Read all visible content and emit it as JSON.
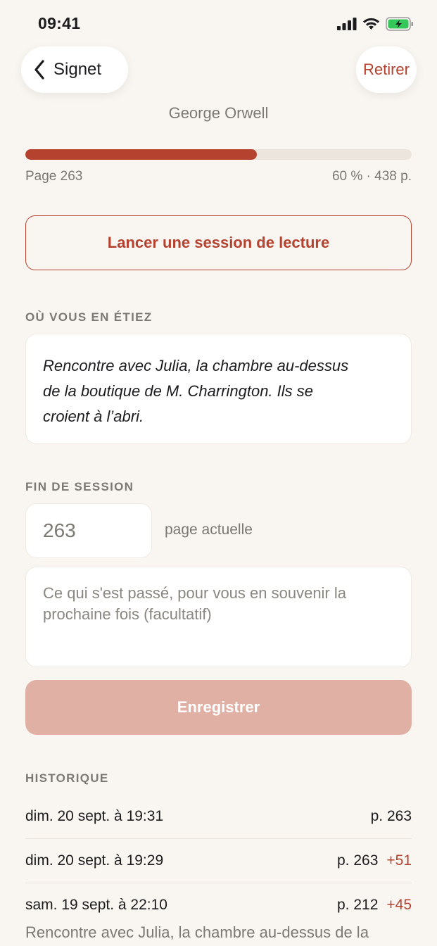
{
  "status": {
    "time": "09:41"
  },
  "nav": {
    "back_label": "Signet",
    "remove_label": "Retirer"
  },
  "book": {
    "author": "George Orwell"
  },
  "progress": {
    "fraction": 0.6,
    "page_label": "Page 263",
    "stats": "60 % · 438 p."
  },
  "session": {
    "start_label": "Lancer une session de lecture"
  },
  "where": {
    "title": "OÙ VOUS EN ÉTIEZ",
    "note_lines": [
      "Rencontre avec Julia, la chambre au-dessus",
      "de la boutique de M. Charrington. Ils se",
      "croient à l’abri."
    ]
  },
  "end_session": {
    "title": "FIN DE SESSION",
    "page_value": "263",
    "page_label": "page actuelle",
    "summary_placeholder_lines": [
      "Ce qui s'est passé, pour vous en souvenir la",
      "prochaine fois (facultatif)"
    ],
    "save_label": "Enregistrer"
  },
  "history": {
    "title": "HISTORIQUE",
    "entries": [
      {
        "date": "dim. 20 sept. à 19:31",
        "page": "p. 263",
        "delta": ""
      },
      {
        "date": "dim. 20 sept. à 19:29",
        "page": "p. 263",
        "delta": "+51"
      },
      {
        "date": "sam. 19 sept. à 22:10",
        "page": "p. 212",
        "delta": "+45"
      }
    ],
    "last_note": "Rencontre avec Julia, la chambre au-dessus de la"
  },
  "colors": {
    "accent": "#b5412f",
    "background": "#f9f6f1",
    "muted_button": "#e0b0a4"
  }
}
